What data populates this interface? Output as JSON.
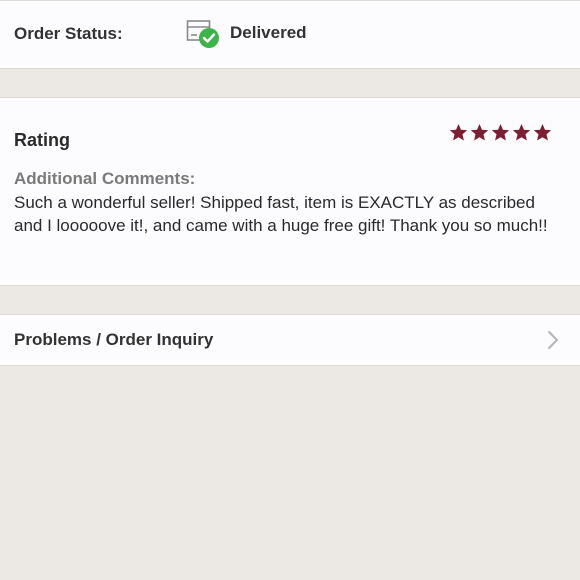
{
  "order_status": {
    "label": "Order Status:",
    "value": "Delivered",
    "icon": "delivered-box-check-icon",
    "check_color": "#3db44a"
  },
  "rating": {
    "label": "Rating",
    "stars": 5,
    "max_stars": 5,
    "star_color": "#7d1f32",
    "comments_label": "Additional Comments:",
    "comments_text": "Such a wonderful seller! Shipped fast, item is EXACTLY as described and I looooove it!, and came with a huge free gift! Thank you so much!!"
  },
  "inquiry": {
    "label": "Problems / Order Inquiry",
    "icon": "chevron-right-icon"
  }
}
